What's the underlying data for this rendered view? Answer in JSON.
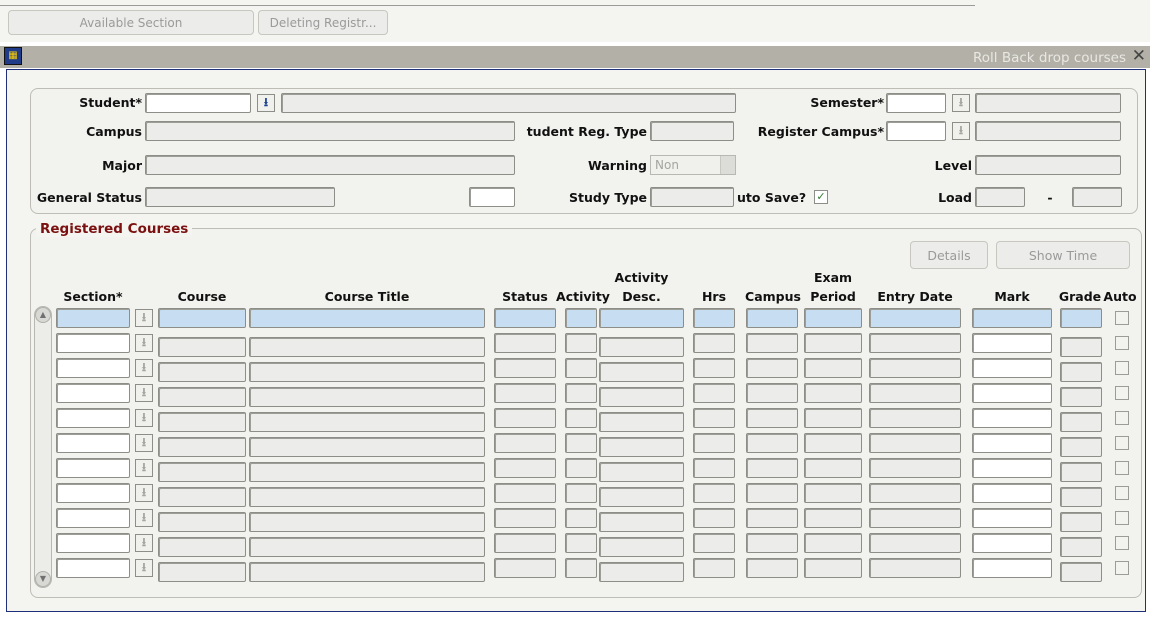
{
  "toolbar": {
    "btn1": "Available Section",
    "btn2": "Deleting Registr..."
  },
  "window": {
    "title": "Roll Back drop courses",
    "close": "✕"
  },
  "form": {
    "student_label": "Student*",
    "campus_label": "Campus",
    "major_label": "Major",
    "general_status_label": "General Status",
    "semester_label": "Semester*",
    "student_reg_type_label": "tudent Reg. Type",
    "register_campus_label": "Register Campus*",
    "warning_label": "Warning",
    "warning_value": "Non",
    "level_label": "Level",
    "study_type_label": "Study Type",
    "auto_save_label": "uto Save?",
    "auto_save_checked": "✓",
    "load_label": "Load",
    "load_sep": "-"
  },
  "registered": {
    "title": "Registered Courses",
    "details_button": "Details",
    "show_time_button": "Show Time",
    "columns": {
      "section": "Section*",
      "course": "Course",
      "course_title": "Course Title",
      "status": "Status",
      "activity": "Activity",
      "activity_desc_1": "Activity",
      "activity_desc_2": "Desc.",
      "hrs": "Hrs",
      "campus": "Campus",
      "exam_period_1": "Exam",
      "exam_period_2": "Period",
      "entry_date": "Entry Date",
      "mark": "Mark",
      "grade": "Grade",
      "auto": "Auto"
    },
    "row_count": 11
  },
  "icons": {
    "lov": "⭳",
    "scroll_up": "▲",
    "scroll_down": "▼"
  }
}
